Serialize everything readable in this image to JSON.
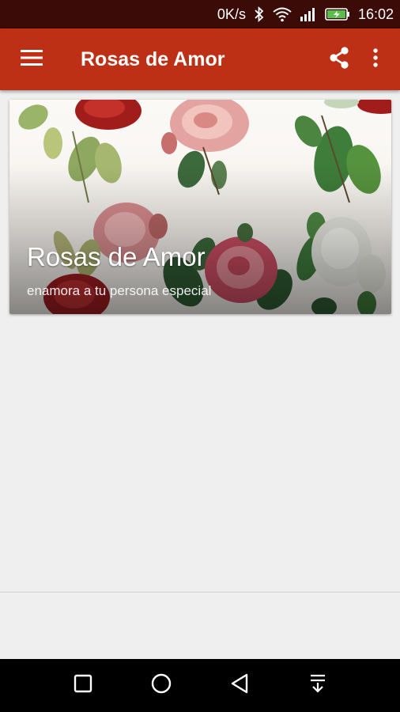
{
  "status_bar": {
    "net_speed": "0K/s",
    "time": "16:02",
    "icons": [
      "bluetooth-icon",
      "wifi-icon",
      "signal-icon",
      "battery-charging-icon"
    ]
  },
  "app_bar": {
    "title": "Rosas de Amor",
    "background": "#bd3016",
    "icons": [
      "menu-icon",
      "share-icon",
      "more-vert-icon"
    ]
  },
  "card": {
    "title": "Rosas de Amor",
    "subtitle": "enamora a tu persona especial"
  },
  "nav_bar": {
    "icons": [
      "recents-square-icon",
      "home-circle-icon",
      "back-triangle-icon",
      "notification-pulldown-icon"
    ]
  }
}
